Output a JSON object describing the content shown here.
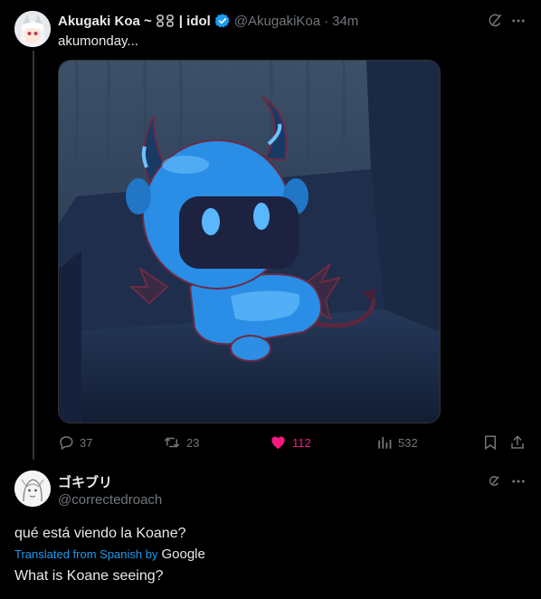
{
  "main_tweet": {
    "display_name": "Akugaki Koa ~",
    "name_suffix": "| idol",
    "handle": "@AkugakiKoa",
    "separator": "·",
    "time": "34m",
    "text": "akumonday...",
    "image_alt_icon": "robot-devil-plush-illustration",
    "actions": {
      "replies": "37",
      "reposts": "23",
      "likes": "112",
      "views": "532"
    },
    "liked": true,
    "colors": {
      "like": "#f91880",
      "verified": "#1d9bf0"
    }
  },
  "reply_tweet": {
    "display_name": "ゴキブリ",
    "handle": "@correctedroach",
    "text": "qué está viendo la Koane?",
    "translation_label": "Translated from Spanish by",
    "translation_provider": "Google",
    "translated_text": "What is Koane seeing?"
  }
}
